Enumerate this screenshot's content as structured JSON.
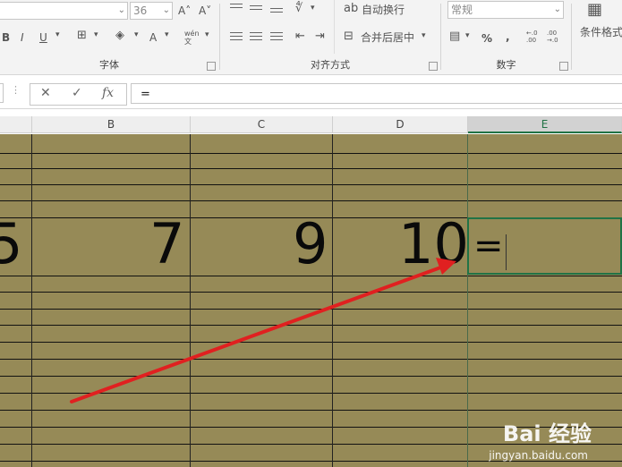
{
  "ribbon": {
    "font_size_value": "36",
    "bold_label": "B",
    "italic_label": "I",
    "underline_label": "U",
    "font_color_label": "A",
    "phonetic_label": "wén 文",
    "grow_font_label": "A˄",
    "shrink_font_label": "A˅",
    "font_group_title": "字体",
    "wrap_text_label": "自动换行",
    "merge_center_label": "合并后居中",
    "alignment_group_title": "对齐方式",
    "number_format_value": "常规",
    "percent_label": "%",
    "comma_label": ",",
    "increase_decimal_label": "←.0 .00",
    "decrease_decimal_label": ".00 →.0",
    "number_group_title": "数字",
    "conditional_format_label": "条件格式"
  },
  "formula_bar": {
    "cancel_glyph": "✕",
    "enter_glyph": "✓",
    "fx_label": "fx",
    "content": "="
  },
  "columns": [
    "B",
    "C",
    "D",
    "E"
  ],
  "cells": {
    "a5_partial": "5",
    "b5": "7",
    "c5": "9",
    "d5": "10",
    "e5": "="
  },
  "watermark": {
    "brand": "Bai 经验",
    "url": "jingyan.baidu.com"
  },
  "colors": {
    "cell_fill": "#968a57",
    "selection": "#217346",
    "annotation_arrow": "#e02020"
  }
}
